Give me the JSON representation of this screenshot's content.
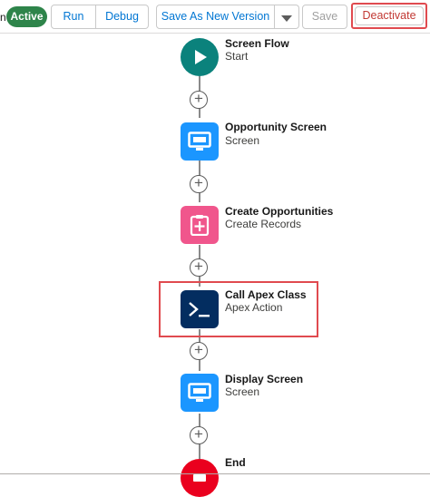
{
  "toolbar": {
    "cut_letter": "n",
    "status_badge": "Active",
    "run_label": "Run",
    "debug_label": "Debug",
    "save_as_new_version_label": "Save As New Version",
    "save_label": "Save",
    "deactivate_label": "Deactivate"
  },
  "flow": {
    "nodes": [
      {
        "title": "Screen Flow",
        "subtitle": "Start",
        "icon": "play-icon",
        "color": "#0b827c"
      },
      {
        "title": "Opportunity Screen",
        "subtitle": "Screen",
        "icon": "monitor-icon",
        "color": "#1b96ff"
      },
      {
        "title": "Create Opportunities",
        "subtitle": "Create Records",
        "icon": "clipboard-add-icon",
        "color": "#f0568c"
      },
      {
        "title": "Call Apex Class",
        "subtitle": "Apex Action",
        "icon": "terminal-icon",
        "color": "#032d60"
      },
      {
        "title": "Display Screen",
        "subtitle": "Screen",
        "icon": "monitor-icon",
        "color": "#1b96ff"
      },
      {
        "title": "End",
        "subtitle": "",
        "icon": "stop-icon",
        "color": "#ea001e"
      }
    ],
    "add_element_symbol": "+"
  },
  "colors": {
    "accent": "#0176d3",
    "active_badge": "#2e844a",
    "highlight": "#e04a4f"
  }
}
